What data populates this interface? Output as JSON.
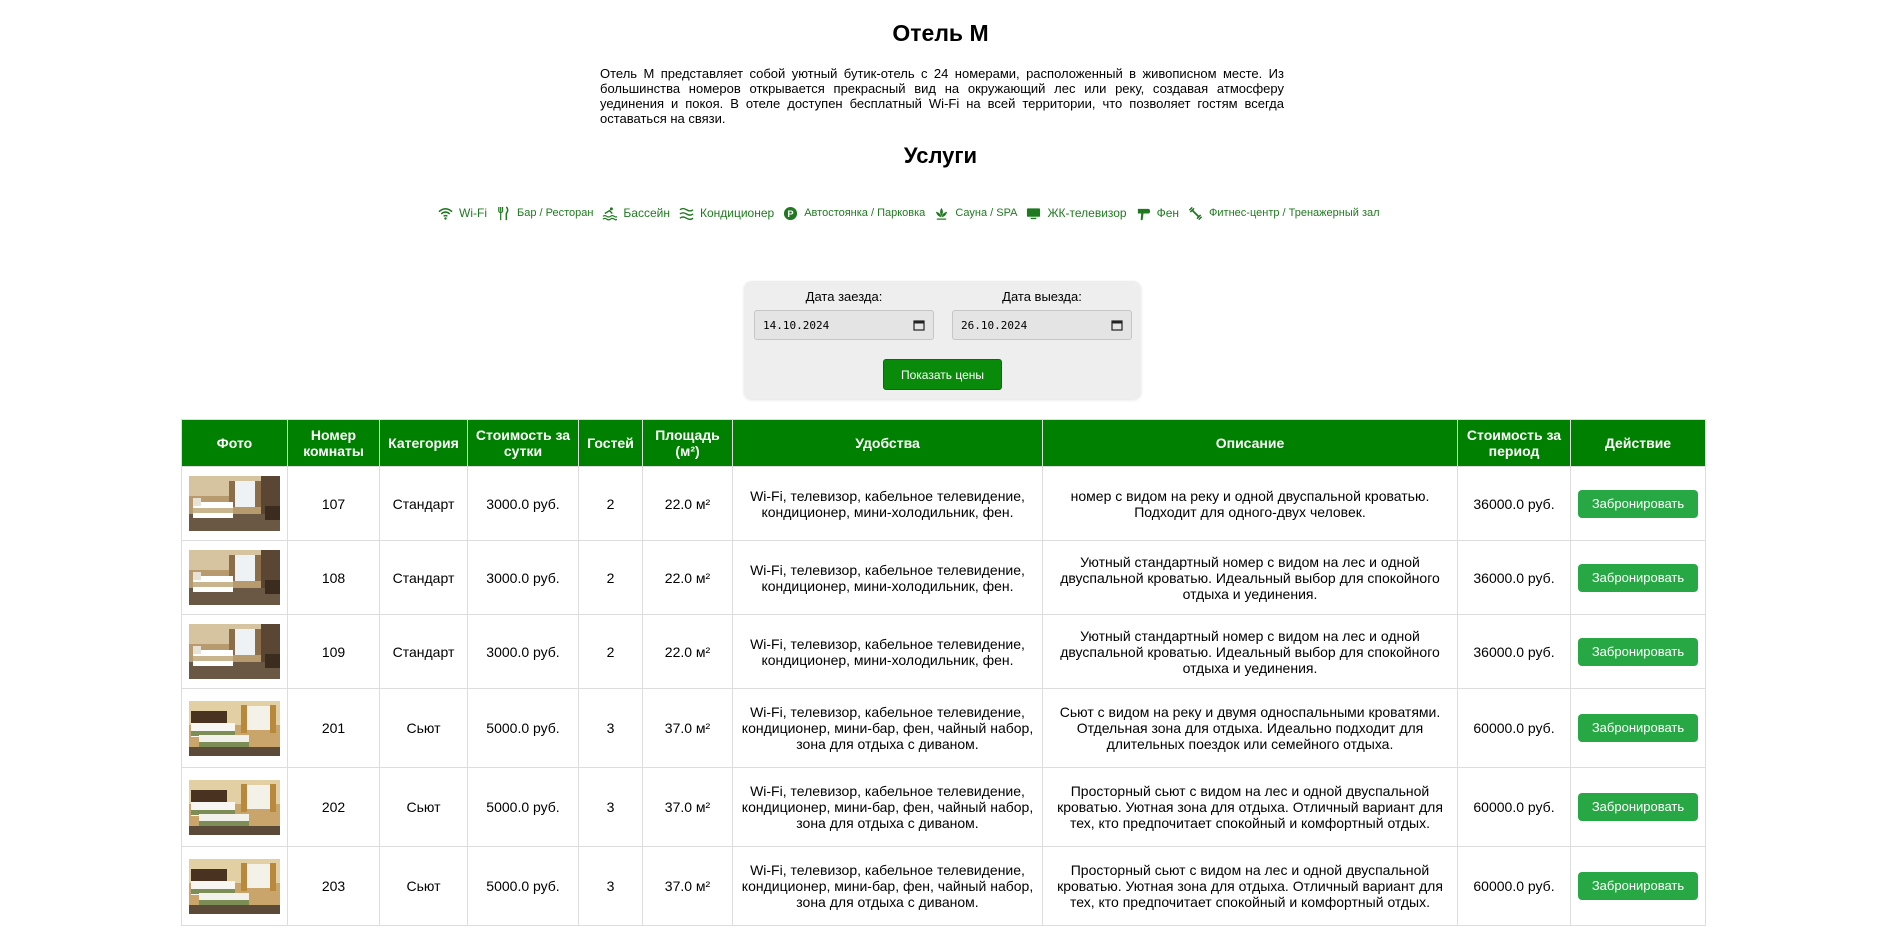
{
  "hotel": {
    "name": "Отель М",
    "description": "Отель М представляет собой уютный бутик-отель с 24 номерами, расположенный в живописном месте. Из большинства номеров открывается прекрасный вид на окружающий лес или реку, создавая атмосферу уединения и покоя. В отеле доступен бесплатный Wi-Fi на всей территории, что позволяет гостям всегда оставаться на связи."
  },
  "services": {
    "title": "Услуги",
    "items": [
      {
        "label": "Wi-Fi",
        "icon": "wifi-icon"
      },
      {
        "label": "Бар / Ресторан",
        "icon": "restaurant-icon"
      },
      {
        "label": "Бассейн",
        "icon": "pool-icon"
      },
      {
        "label": "Кондиционер",
        "icon": "air-conditioner-icon"
      },
      {
        "label": "Автостоянка / Парковка",
        "icon": "parking-icon"
      },
      {
        "label": "Сауна / SPA",
        "icon": "spa-icon"
      },
      {
        "label": "ЖК-телевизор",
        "icon": "tv-icon"
      },
      {
        "label": "Фен",
        "icon": "hair-dryer-icon"
      },
      {
        "label": "Фитнес-центр / Тренажерный зал",
        "icon": "fitness-icon"
      }
    ]
  },
  "booking": {
    "checkin_label": "Дата заезда:",
    "checkin_value": "14.10.2024",
    "checkout_label": "Дата выезда:",
    "checkout_value": "26.10.2024",
    "show_prices_button": "Показать цены"
  },
  "table": {
    "headers": [
      "Фото",
      "Номер комнаты",
      "Категория",
      "Стоимость за сутки",
      "Гостей",
      "Площадь (м²)",
      "Удобства",
      "Описание",
      "Стоимость за период",
      "Действие"
    ],
    "book_label": "Забронировать",
    "rows": [
      {
        "number": "107",
        "category": "Стандарт",
        "price": "3000.0 руб.",
        "guests": "2",
        "area": "22.0 м²",
        "amenities": "Wi-Fi, телевизор, кабельное телевидение, кондиционер, мини-холодильник, фен.",
        "description": "номер с видом на реку и одной двуспальной кроватью. Подходит для одного-двух человек.",
        "total": "36000.0 руб."
      },
      {
        "number": "108",
        "category": "Стандарт",
        "price": "3000.0 руб.",
        "guests": "2",
        "area": "22.0 м²",
        "amenities": "Wi-Fi, телевизор, кабельное телевидение, кондиционер, мини-холодильник, фен.",
        "description": "Уютный стандартный номер с видом на лес и одной двуспальной кроватью. Идеальный выбор для спокойного отдыха и уединения.",
        "total": "36000.0 руб."
      },
      {
        "number": "109",
        "category": "Стандарт",
        "price": "3000.0 руб.",
        "guests": "2",
        "area": "22.0 м²",
        "amenities": "Wi-Fi, телевизор, кабельное телевидение, кондиционер, мини-холодильник, фен.",
        "description": "Уютный стандартный номер с видом на лес и одной двуспальной кроватью. Идеальный выбор для спокойного отдыха и уединения.",
        "total": "36000.0 руб."
      },
      {
        "number": "201",
        "category": "Сьют",
        "price": "5000.0 руб.",
        "guests": "3",
        "area": "37.0 м²",
        "amenities": "Wi-Fi, телевизор, кабельное телевидение, кондиционер, мини-бар, фен, чайный набор, зона для отдыха с диваном.",
        "description": "Сьют с видом на реку и двумя односпальными кроватями. Отдельная зона для отдыха. Идеально подходит для длительных поездок или семейного отдыха.",
        "total": "60000.0 руб."
      },
      {
        "number": "202",
        "category": "Сьют",
        "price": "5000.0 руб.",
        "guests": "3",
        "area": "37.0 м²",
        "amenities": "Wi-Fi, телевизор, кабельное телевидение, кондиционер, мини-бар, фен, чайный набор, зона для отдыха с диваном.",
        "description": "Просторный сьют с видом на лес и одной двуспальной кроватью. Уютная зона для отдыха. Отличный вариант для тех, кто предпочитает спокойный и комфортный отдых.",
        "total": "60000.0 руб."
      },
      {
        "number": "203",
        "category": "Сьют",
        "price": "5000.0 руб.",
        "guests": "3",
        "area": "37.0 м²",
        "amenities": "Wi-Fi, телевизор, кабельное телевидение, кондиционер, мини-бар, фен, чайный набор, зона для отдыха с диваном.",
        "description": "Просторный сьют с видом на лес и одной двуспальной кроватью. Уютная зона для отдыха. Отличный вариант для тех, кто предпочитает спокойный и комфортный отдых.",
        "total": "60000.0 руб."
      }
    ]
  },
  "colors": {
    "header_green": "#008000",
    "button_green": "#28a745",
    "show_button_green": "#0a8a0a",
    "icon_green": "#1f7a1f"
  }
}
